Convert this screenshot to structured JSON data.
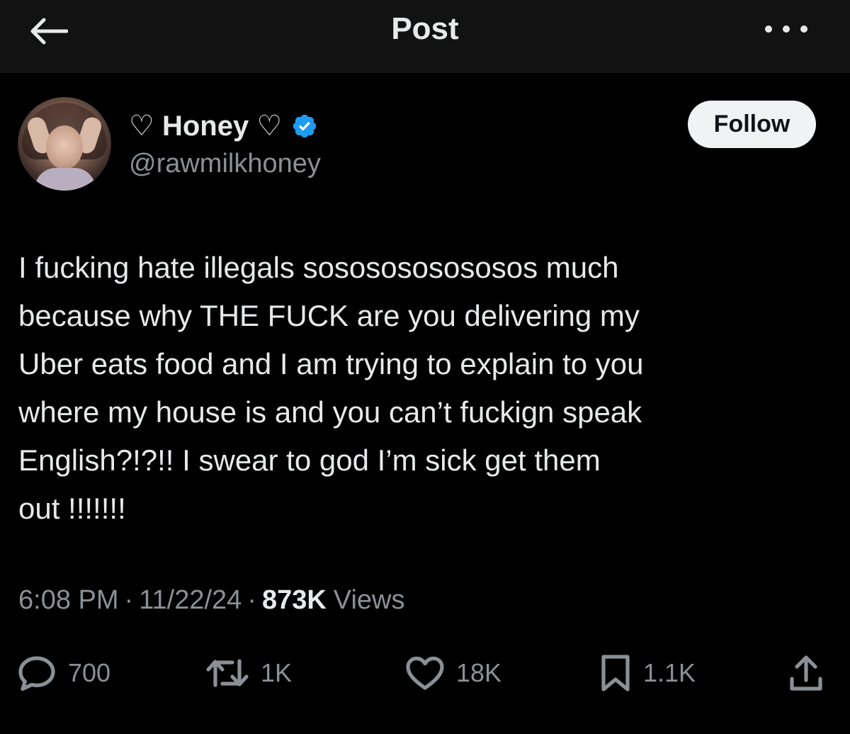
{
  "header": {
    "title": "Post",
    "back_icon": "arrow-left-icon",
    "more_icon": "more-horizontal-icon"
  },
  "author": {
    "display_name": "♡ Honey ♡",
    "handle": "@rawmilkhoney",
    "verified": true,
    "verified_color": "#1d9bf0"
  },
  "follow_button": {
    "label": "Follow"
  },
  "post": {
    "lines": [
      "I fucking hate illegals sososososososos much",
      "because why THE FUCK are you delivering my",
      "Uber eats food and I am trying to explain to you",
      "where my house is and you can’t fuckign speak",
      "English?!?!! I swear to god I’m sick get them",
      "out !!!!!!!"
    ]
  },
  "meta": {
    "time": "6:08 PM",
    "date": "11/22/24",
    "views_count": "873K",
    "views_label": "Views"
  },
  "actions": {
    "replies": "700",
    "reposts": "1K",
    "likes": "18K",
    "bookmarks": "1.1K"
  },
  "colors": {
    "background": "#000000",
    "header_bg": "#121212",
    "text": "#e7e9ea",
    "muted": "#8b9096",
    "follow_bg": "#eff3f4"
  }
}
